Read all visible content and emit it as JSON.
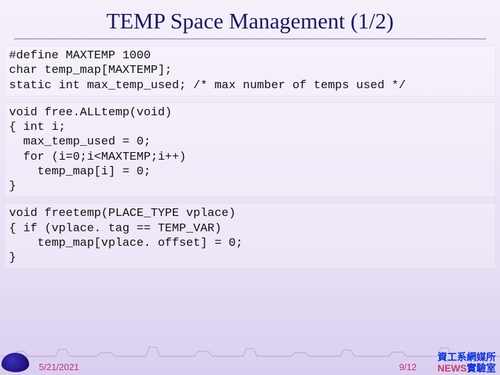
{
  "title": "TEMP Space Management (1/2)",
  "code": {
    "block1": "#define MAXTEMP 1000\nchar temp_map[MAXTEMP];\nstatic int max_temp_used; /* max number of temps used */",
    "block2": "void free.ALLtemp(void)\n{ int i;\n  max_temp_used = 0;\n  for (i=0;i<MAXTEMP;i++)\n    temp_map[i] = 0;\n}",
    "block3": "void freetemp(PLACE_TYPE vplace)\n{ if (vplace. tag == TEMP_VAR)\n    temp_map[vplace. offset] = 0;\n}"
  },
  "footer": {
    "date": "5/21/2021",
    "page": "9/12",
    "lab_line1": "資工系網媒所",
    "lab_news": "NEWS",
    "lab_rest": "實驗室"
  }
}
